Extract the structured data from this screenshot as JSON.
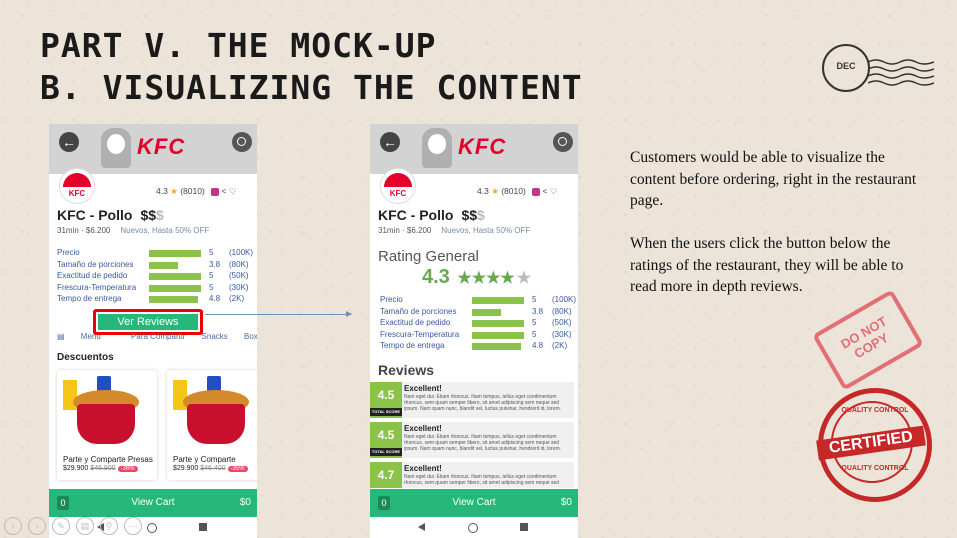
{
  "slide": {
    "title_line1": "PART V. THE MOCK-UP",
    "title_line2": "B. VISUALIZING THE CONTENT",
    "paragraph1": "Customers would be able to visualize the content before ordering, right in the restaurant page.",
    "paragraph2": "When the users click the button below the ratings of the restaurant, they will be able to read more in depth reviews.",
    "stamp_postmark": "DEC",
    "stamp_do_not_copy": "DO NOT COPY",
    "stamp_certified": "CERTIFIED",
    "stamp_quality_top": "QUALITY CONTROL",
    "stamp_quality_bottom": "QUALITY CONTROL"
  },
  "restaurant": {
    "brand": "KFC",
    "logo_text": "KFC",
    "name": "KFC - Pollo",
    "price_level": "$$",
    "price_level_inactive": "$",
    "rating": "4.3",
    "rating_star": "★",
    "review_count": "(8010)",
    "time": "31min",
    "fee": "$6.200",
    "offer": "Nuevos, Hasta 50% OFF"
  },
  "ratings": [
    {
      "label": "Precio",
      "value": "5",
      "count": "(100K)",
      "fill": 1.0
    },
    {
      "label": "Tamaño de porciones",
      "value": "3.8",
      "count": "(80K)",
      "fill": 0.55
    },
    {
      "label": "Exactitud de pedido",
      "value": "5",
      "count": "(50K)",
      "fill": 1.0
    },
    {
      "label": "Frescura-Temperatura",
      "value": "5",
      "count": "(30K)",
      "fill": 1.0
    },
    {
      "label": "Tempo de entrega",
      "value": "4.8",
      "count": "(2K)",
      "fill": 0.95
    }
  ],
  "screen1": {
    "ver_reviews": "Ver Reviews",
    "menu_tabs": [
      "Menu",
      "Para Compartir",
      "Snacks",
      "Boxes"
    ],
    "section_title": "Descuentos",
    "products": [
      {
        "name": "Parte y Comparte Presas",
        "price": "$29.900",
        "old_price": "$46.900",
        "discount": "-36%"
      },
      {
        "name": "Parte y Comparte",
        "price": "$29.900",
        "old_price": "$46.400",
        "discount": "-35%"
      }
    ],
    "cart": {
      "qty": "0",
      "label": "View Cart",
      "amount": "$0"
    }
  },
  "screen2": {
    "rating_general_label": "Rating General",
    "rating_general_value": "4.3",
    "rating_general_stars": "★★★★",
    "rating_general_half": "★",
    "reviews_title": "Reviews",
    "reviews": [
      {
        "score": "4.5",
        "badge": "TOTAL SCORE",
        "title": "Excellent!",
        "text": "Nam eget dui. Etiam rhoncus. Nam tempus, tellus eget condimentum rhoncus, sem quam semper libero, sit amet adipiscing sem neque sed ipsum. Nam quam nunc, blandit vel, luctus pulvinar, hendrerit id, lorem."
      },
      {
        "score": "4.5",
        "badge": "TOTAL SCORE",
        "title": "Excellent!",
        "text": "Nam eget dui. Etiam rhoncus. Nam tempus, tellus eget condimentum rhoncus, sem quam semper libero, sit amet adipiscing sem neque sed ipsum. Nam quam nunc, blandit vel, luctus pulvinar, hendrerit id, lorem."
      },
      {
        "score": "4.7",
        "badge": "",
        "title": "Excellent!",
        "text": "Nam eget dui. Etiam rhoncus. Nam tempus, tellus eget condimentum rhoncus, sem quam semper libero, sit amet adipiscing sem neque sed ipsum."
      }
    ],
    "cart": {
      "qty": "0",
      "label": "View Cart",
      "amount": "$0"
    }
  },
  "colors": {
    "accent_green": "#25b87a",
    "bar_green": "#8bc34a",
    "kfc_red": "#e4002b",
    "highlight": "#ee0000"
  },
  "icons": [
    "back-arrow-icon",
    "search-icon",
    "instagram-icon",
    "share-icon",
    "heart-icon",
    "menu-book-icon",
    "nav-back-icon",
    "nav-home-icon",
    "nav-recents-icon"
  ]
}
